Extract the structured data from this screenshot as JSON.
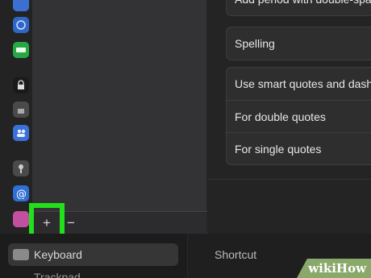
{
  "list_toolbar": {
    "add_label": "+",
    "remove_label": "−"
  },
  "text_options": {
    "group1": [
      "Add period with double-space"
    ],
    "group2": [
      "Spelling"
    ],
    "group3": [
      "Use smart quotes and dashes",
      "For double quotes",
      "For single quotes"
    ]
  },
  "sidebar": {
    "keyboard_label": "Keyboard",
    "trackpad_label": "Trackpad"
  },
  "detail": {
    "shortcut_label": "Shortcut"
  },
  "watermark": {
    "text": "wikiHow"
  },
  "colors": {
    "highlight": "#22e01c",
    "watermark_bg": "#8aa86a"
  }
}
